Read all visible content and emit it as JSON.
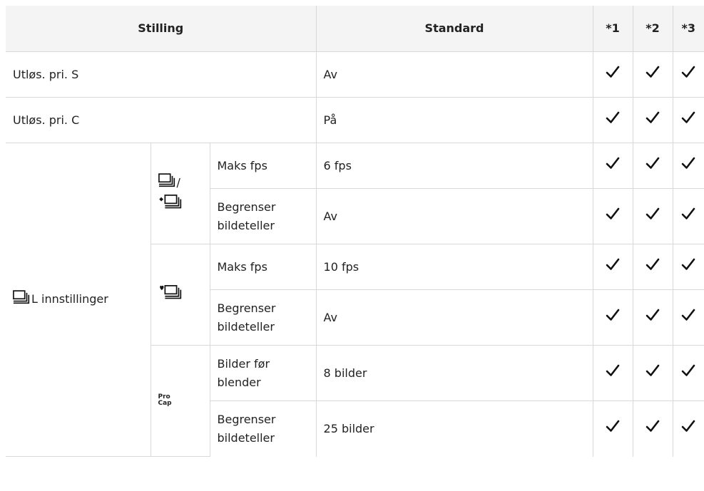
{
  "header": {
    "col1": "Stilling",
    "col2": "Standard",
    "col3": "*1",
    "col4": "*2",
    "col5": "*3"
  },
  "rows": [
    {
      "label": "Utløs. pri. S",
      "standard": "Av"
    },
    {
      "label": "Utløs. pri. C",
      "standard": "På"
    }
  ],
  "group": {
    "label": "L innstillinger",
    "label_icon": "sequential-shooting-low-icon",
    "sub1": {
      "icon_name": "sequential-low-and-silent-sequential-low-icon",
      "icon_sep": "/",
      "items": [
        {
          "name": "Maks fps",
          "standard": "6 fps"
        },
        {
          "name_line1": "Begrenser",
          "name_line2": "bildeteller",
          "standard": "Av"
        }
      ]
    },
    "sub2": {
      "icon_name": "silent-sequential-icon",
      "items": [
        {
          "name": "Maks fps",
          "standard": "10 fps"
        },
        {
          "name_line1": "Begrenser",
          "name_line2": "bildeteller",
          "standard": "Av"
        }
      ]
    },
    "sub3": {
      "icon_name": "pro-capture-icon",
      "icon_text_top": "Pro",
      "icon_text_bottom": "Cap",
      "items": [
        {
          "name_line1": "Bilder før",
          "name_line2": "blender",
          "standard": "8 bilder"
        },
        {
          "name_line1": "Begrenser",
          "name_line2": "bildeteller",
          "standard": "25 bilder"
        }
      ]
    }
  },
  "check_icon": "checkmark-icon"
}
